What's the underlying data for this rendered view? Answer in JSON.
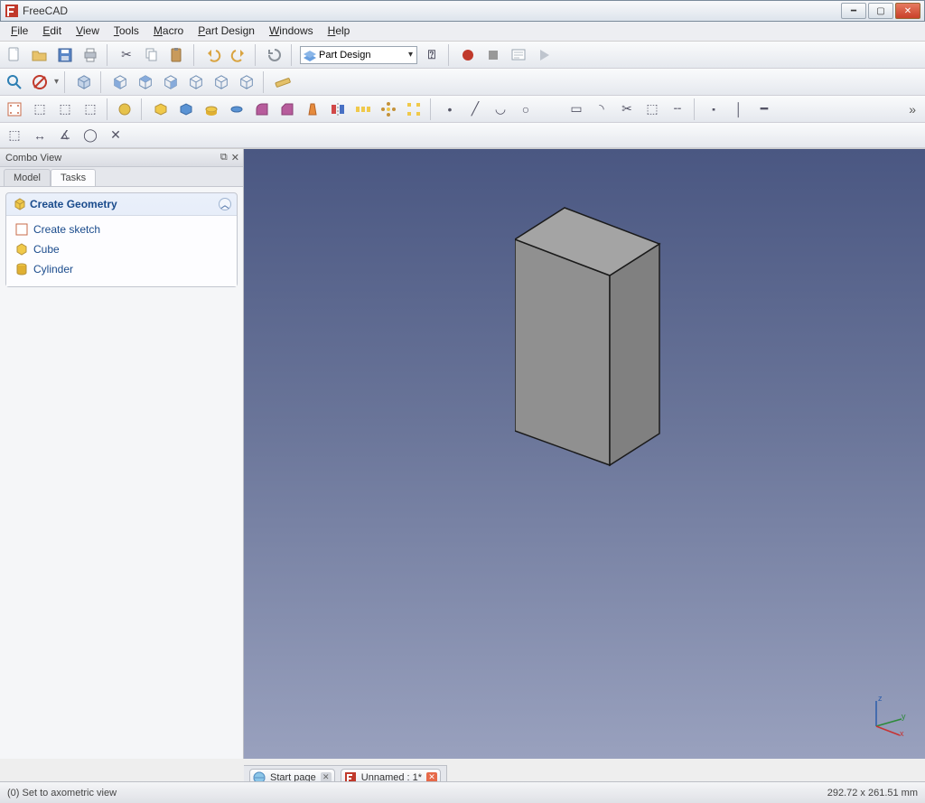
{
  "window": {
    "title": "FreeCAD"
  },
  "menus": [
    "File",
    "Edit",
    "View",
    "Tools",
    "Macro",
    "Part Design",
    "Windows",
    "Help"
  ],
  "workbench_selector": {
    "value": "Part Design"
  },
  "sidebar": {
    "title": "Combo View",
    "tabs": [
      "Model",
      "Tasks"
    ],
    "active_tab": 1,
    "task_group": {
      "title": "Create Geometry",
      "items": [
        "Create sketch",
        "Cube",
        "Cylinder"
      ]
    }
  },
  "doc_tabs": [
    {
      "label": "Start page",
      "active": false
    },
    {
      "label": "Unnamed : 1*",
      "active": true
    }
  ],
  "status": {
    "left": "(0) Set to axometric view",
    "right": "292.72 x 261.51 mm"
  }
}
